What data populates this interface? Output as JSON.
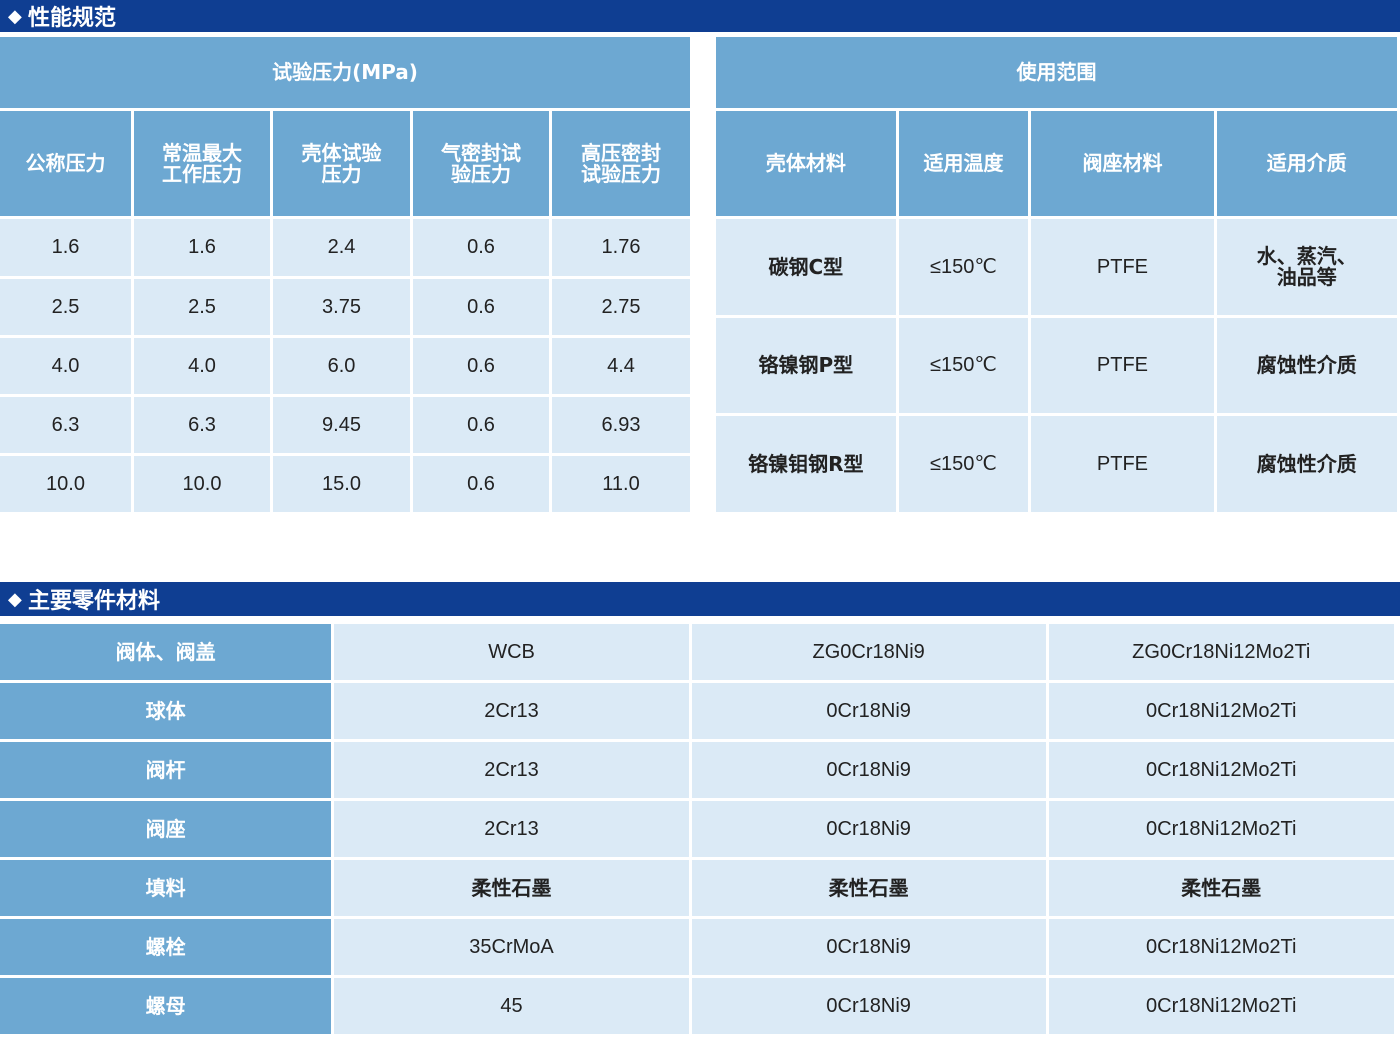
{
  "sections": {
    "performance_title": "性能规范",
    "parts_title": "主要零件材料",
    "diamond": "◆"
  },
  "perf": {
    "group_header": "试验压力(MPa)",
    "headers": [
      "公称压力",
      "常温最大工作压力",
      "壳体试验压力",
      "气密封试验压力",
      "高压密封试验压力"
    ],
    "rows": [
      [
        "1.6",
        "1.6",
        "2.4",
        "0.6",
        "1.76"
      ],
      [
        "2.5",
        "2.5",
        "3.75",
        "0.6",
        "2.75"
      ],
      [
        "4.0",
        "4.0",
        "6.0",
        "0.6",
        "4.4"
      ],
      [
        "6.3",
        "6.3",
        "9.45",
        "0.6",
        "6.93"
      ],
      [
        "10.0",
        "10.0",
        "15.0",
        "0.6",
        "11.0"
      ]
    ]
  },
  "range": {
    "group_header": "使用范围",
    "headers": [
      "壳体材料",
      "适用温度",
      "阀座材料",
      "适用介质"
    ],
    "rows": [
      [
        "碳钢C型",
        "≤150℃",
        "PTFE",
        "水、蒸汽、油品等"
      ],
      [
        "铬镍钢P型",
        "≤150℃",
        "PTFE",
        "腐蚀性介质"
      ],
      [
        "铬镍钼钢R型",
        "≤150℃",
        "PTFE",
        "腐蚀性介质"
      ]
    ]
  },
  "parts": {
    "rows": [
      [
        "阀体、阀盖",
        "WCB",
        "ZG0Cr18Ni9",
        "ZG0Cr18Ni12Mo2Ti"
      ],
      [
        "球体",
        "2Cr13",
        "0Cr18Ni9",
        "0Cr18Ni12Mo2Ti"
      ],
      [
        "阀杆",
        "2Cr13",
        "0Cr18Ni9",
        "0Cr18Ni12Mo2Ti"
      ],
      [
        "阀座",
        "2Cr13",
        "0Cr18Ni9",
        "0Cr18Ni12Mo2Ti"
      ],
      [
        "填料",
        "柔性石墨",
        "柔性石墨",
        "柔性石墨"
      ],
      [
        "螺栓",
        "35CrMoA",
        "0Cr18Ni9",
        "0Cr18Ni12Mo2Ti"
      ],
      [
        "螺母",
        "45",
        "0Cr18Ni9",
        "0Cr18Ni12Mo2Ti"
      ]
    ]
  }
}
